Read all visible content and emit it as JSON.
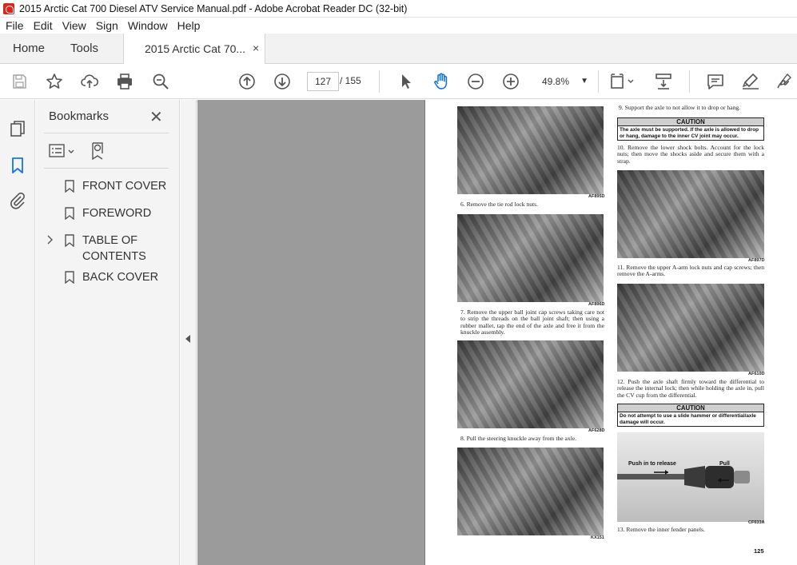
{
  "window": {
    "title": "2015 Arctic Cat 700 Diesel ATV Service Manual.pdf - Adobe Acrobat Reader DC (32-bit)"
  },
  "menu": [
    "File",
    "Edit",
    "View",
    "Sign",
    "Window",
    "Help"
  ],
  "tabs": {
    "home": "Home",
    "tools": "Tools",
    "document": "2015 Arctic Cat 70...",
    "close": "×"
  },
  "toolbar": {
    "page_current": "127",
    "page_total": "/ 155",
    "zoom": "49.8%",
    "icons": [
      "save-icon",
      "star-icon",
      "upload-icon",
      "print-icon",
      "zoom-search-icon",
      "page-up-icon",
      "page-down-icon",
      "select-cursor-icon",
      "hand-tool-icon",
      "zoom-out-icon",
      "zoom-in-icon",
      "fit-page-icon",
      "scroll-mode-icon",
      "comment-icon",
      "highlight-icon",
      "sign-icon"
    ]
  },
  "bookmarks": {
    "title": "Bookmarks",
    "close": "✕",
    "items": [
      {
        "label": "FRONT COVER",
        "expandable": false
      },
      {
        "label": "FOREWORD",
        "expandable": false
      },
      {
        "label": "TABLE OF CONTENTS",
        "expandable": true
      },
      {
        "label": "BACK COVER",
        "expandable": false
      }
    ]
  },
  "pdf_page": {
    "page_number": "125",
    "left_column": {
      "photo_codes": [
        "AF895D",
        "AF896D",
        "AF628D",
        "KX151"
      ],
      "steps": [
        "6. Remove the tie rod lock nuts.",
        "7. Remove the upper ball joint cap screws taking care not to strip the threads on the ball joint shaft; then using a rubber mallet, tap the end of the axle and free it from the knuckle assembly.",
        "8. Pull the steering knuckle away from the axle."
      ]
    },
    "right_column": {
      "step9": "9. Support the axle to not allow it to drop or hang.",
      "caution1_head": "CAUTION",
      "caution1_body": "The axle must be supported. If the axle is allowed to drop or hang, damage to the inner CV joint may occur.",
      "step10": "10. Remove the lower shock bolts. Account for the lock nuts; then move the shocks aside and secure them with a strap.",
      "photo_codes": [
        "AF897D",
        "AF610D",
        "CF633A"
      ],
      "step11": "11. Remove the upper A-arm lock nuts and cap screws; then remove the A-arms.",
      "step12": "12. Push the axle shaft firmly toward the differential to release the internal lock; then while holding the axle in, pull the CV cup from the differential.",
      "caution2_head": "CAUTION",
      "caution2_body": "Do not attempt to use a slide hammer or differential/axle damage will occur.",
      "callout_push": "Push in to release",
      "callout_pull": "Pull",
      "step13": "13. Remove the inner fender panels."
    }
  }
}
